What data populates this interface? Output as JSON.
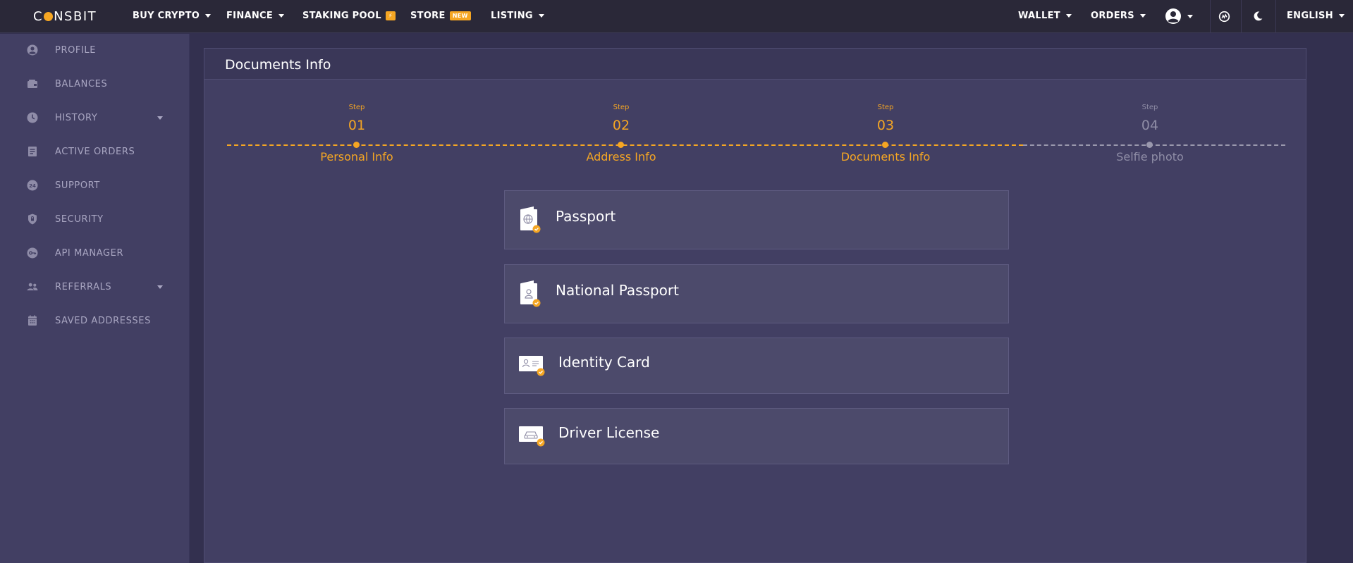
{
  "brand": {
    "logo_left": "C",
    "logo_right": "NSBIT"
  },
  "topnav": {
    "left": [
      {
        "label": "BUY CRYPTO"
      },
      {
        "label": "FINANCE"
      },
      {
        "label": "STAKING POOL",
        "badge": "⚡"
      },
      {
        "label": "STORE",
        "badge": "NEW"
      },
      {
        "label": "LISTING"
      }
    ],
    "right": {
      "wallet": "WALLET",
      "orders": "ORDERS",
      "language": "ENGLISH"
    }
  },
  "sidebar": {
    "items": [
      {
        "label": "PROFILE",
        "icon": "user-circle-icon"
      },
      {
        "label": "BALANCES",
        "icon": "wallet-icon"
      },
      {
        "label": "HISTORY",
        "icon": "clock-icon",
        "expandable": true
      },
      {
        "label": "ACTIVE ORDERS",
        "icon": "orders-icon"
      },
      {
        "label": "SUPPORT",
        "icon": "support-24-icon"
      },
      {
        "label": "SECURITY",
        "icon": "shield-icon"
      },
      {
        "label": "API MANAGER",
        "icon": "key-icon"
      },
      {
        "label": "REFERRALS",
        "icon": "users-icon",
        "expandable": true
      },
      {
        "label": "SAVED ADDRESSES",
        "icon": "calendar-icon"
      }
    ]
  },
  "main": {
    "title": "Documents Info",
    "steps": [
      {
        "small": "Step",
        "num": "01",
        "name": "Personal Info",
        "done": true
      },
      {
        "small": "Step",
        "num": "02",
        "name": "Address Info",
        "done": true
      },
      {
        "small": "Step",
        "num": "03",
        "name": "Documents Info",
        "done": true
      },
      {
        "small": "Step",
        "num": "04",
        "name": "Selfie photo",
        "done": false
      }
    ],
    "documents": [
      {
        "label": "Passport",
        "icon": "passport-icon"
      },
      {
        "label": "National Passport",
        "icon": "national-passport-icon"
      },
      {
        "label": "Identity Card",
        "icon": "identity-card-icon"
      },
      {
        "label": "Driver License",
        "icon": "driver-license-icon"
      }
    ]
  },
  "colors": {
    "accent": "#f5a623",
    "topbar": "#2a2838",
    "sidebar": "#423f63",
    "background": "#33304f",
    "card": "#423f63",
    "option": "#4c4a6b",
    "muted": "#8f8da6"
  }
}
